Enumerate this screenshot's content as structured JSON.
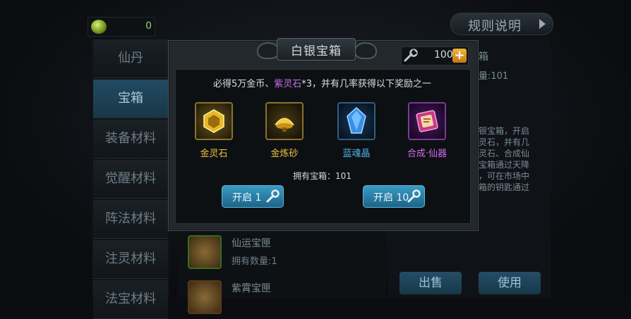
{
  "currency": {
    "icon": "green-gem-icon",
    "value": "0"
  },
  "rules_button": {
    "label": "规则说明",
    "icon": "play-arrow-icon"
  },
  "categories": [
    {
      "label": "仙丹",
      "active": false
    },
    {
      "label": "宝箱",
      "active": true
    },
    {
      "label": "装备材料",
      "active": false
    },
    {
      "label": "觉醒材料",
      "active": false
    },
    {
      "label": "阵法材料",
      "active": false
    },
    {
      "label": "注灵材料",
      "active": false
    },
    {
      "label": "法宝材料",
      "active": false
    }
  ],
  "list_items": [
    {
      "name": "仙运宝匣",
      "count": "拥有数量:1"
    },
    {
      "name": "紫霄宝匣",
      "count": ""
    }
  ],
  "right_panel": {
    "title_fragment": "箱",
    "count_fragment": "量:101",
    "desc_lines": [
      "银宝箱，开启",
      "灵石，并有几",
      "灵石、合成仙",
      "宝箱通过天降",
      "，可在市场中",
      "箱的钥匙通过"
    ],
    "sell_button": "出售",
    "use_button": "使用"
  },
  "modal": {
    "title": "白银宝箱",
    "key_count": "100",
    "plus_label": "+",
    "desc_prefix": "必得5万金币、",
    "desc_highlight": "紫灵石",
    "desc_suffix": "*3，并有几率获得以下奖励之一",
    "rewards": [
      {
        "label": "金灵石",
        "color": "#f0c23a",
        "icon": "gold-spirit-stone-icon"
      },
      {
        "label": "金炼砂",
        "color": "#f0c23a",
        "icon": "gold-refining-sand-icon"
      },
      {
        "label": "蓝魂晶",
        "color": "#4fb4ee",
        "icon": "blue-soul-crystal-icon"
      },
      {
        "label": "合成·仙器",
        "color": "#d46cf0",
        "icon": "synthesis-scroll-icon"
      }
    ],
    "owned": "拥有宝箱：101",
    "open1_label": "开启 1",
    "open10_label": "开启 10"
  }
}
